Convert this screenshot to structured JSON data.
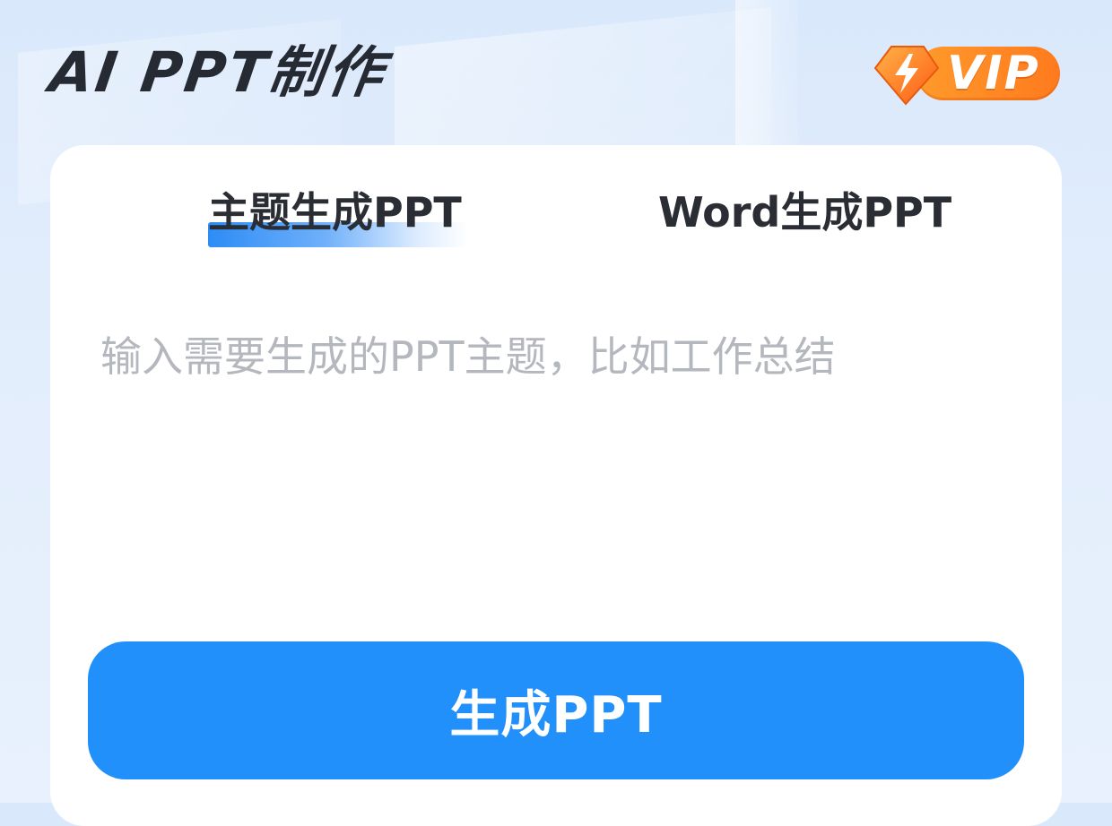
{
  "header": {
    "title": "AI PPT制作",
    "vip_label": "VIP",
    "vip_badge_icon": "lightning-icon"
  },
  "tabs": [
    {
      "label": "主题生成PPT",
      "active": true
    },
    {
      "label": "Word生成PPT",
      "active": false
    }
  ],
  "input": {
    "value": "",
    "placeholder": "输入需要生成的PPT主题，比如工作总结"
  },
  "actions": {
    "generate_label": "生成PPT"
  },
  "colors": {
    "primary": "#2290fb",
    "vip_orange": "#ff8a25",
    "title_text": "#262a33",
    "placeholder": "#b4b7bd"
  }
}
